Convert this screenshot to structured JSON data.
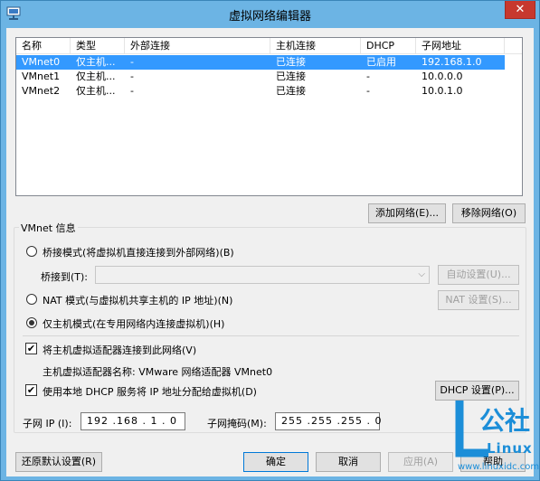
{
  "window": {
    "title": "虚拟网络编辑器",
    "close_label": "✕"
  },
  "list": {
    "columns": [
      "名称",
      "类型",
      "外部连接",
      "主机连接",
      "DHCP",
      "子网地址"
    ],
    "rows": [
      {
        "name": "VMnet0",
        "type": "仅主机...",
        "external": "-",
        "host": "已连接",
        "dhcp": "已启用",
        "subnet": "192.168.1.0"
      },
      {
        "name": "VMnet1",
        "type": "仅主机...",
        "external": "-",
        "host": "已连接",
        "dhcp": "-",
        "subnet": "10.0.0.0"
      },
      {
        "name": "VMnet2",
        "type": "仅主机...",
        "external": "-",
        "host": "已连接",
        "dhcp": "-",
        "subnet": "10.0.1.0"
      }
    ],
    "selected_index": 0
  },
  "buttons": {
    "add_network": "添加网络(E)...",
    "remove_network": "移除网络(O)",
    "auto_settings": "自动设置(U)...",
    "nat_settings": "NAT 设置(S)...",
    "dhcp_settings": "DHCP 设置(P)...",
    "restore_defaults": "还原默认设置(R)",
    "ok": "确定",
    "cancel": "取消",
    "apply": "应用(A)",
    "help": "帮助"
  },
  "vmnet_info": {
    "group_title": "VMnet 信息",
    "bridged_label": "桥接模式(将虚拟机直接连接到外部网络)(B)",
    "bridged_to_label": "桥接到(T):",
    "bridged_to_value": "",
    "nat_label": "NAT 模式(与虚拟机共享主机的 IP 地址)(N)",
    "hostonly_label": "仅主机模式(在专用网络内连接虚拟机)(H)",
    "selected_mode": "hostonly",
    "connect_adapter_label": "将主机虚拟适配器连接到此网络(V)",
    "connect_adapter_checked": true,
    "adapter_name_label": "主机虚拟适配器名称: VMware 网络适配器 VMnet0",
    "use_dhcp_label": "使用本地 DHCP 服务将 IP 地址分配给虚拟机(D)",
    "use_dhcp_checked": true,
    "subnet_ip_label": "子网 IP (I):",
    "subnet_ip_value": "192 .168 . 1 . 0",
    "subnet_mask_label": "子网掩码(M):",
    "subnet_mask_value": "255 .255 .255 . 0"
  },
  "watermark": {
    "logo_text": "公社",
    "brand": "Linux",
    "url": "www.linuxidc.com",
    "color": "#1c8ed8"
  },
  "colors": {
    "titlebar": "#6cb4e4",
    "selection": "#3399ff",
    "close": "#c7382e"
  }
}
